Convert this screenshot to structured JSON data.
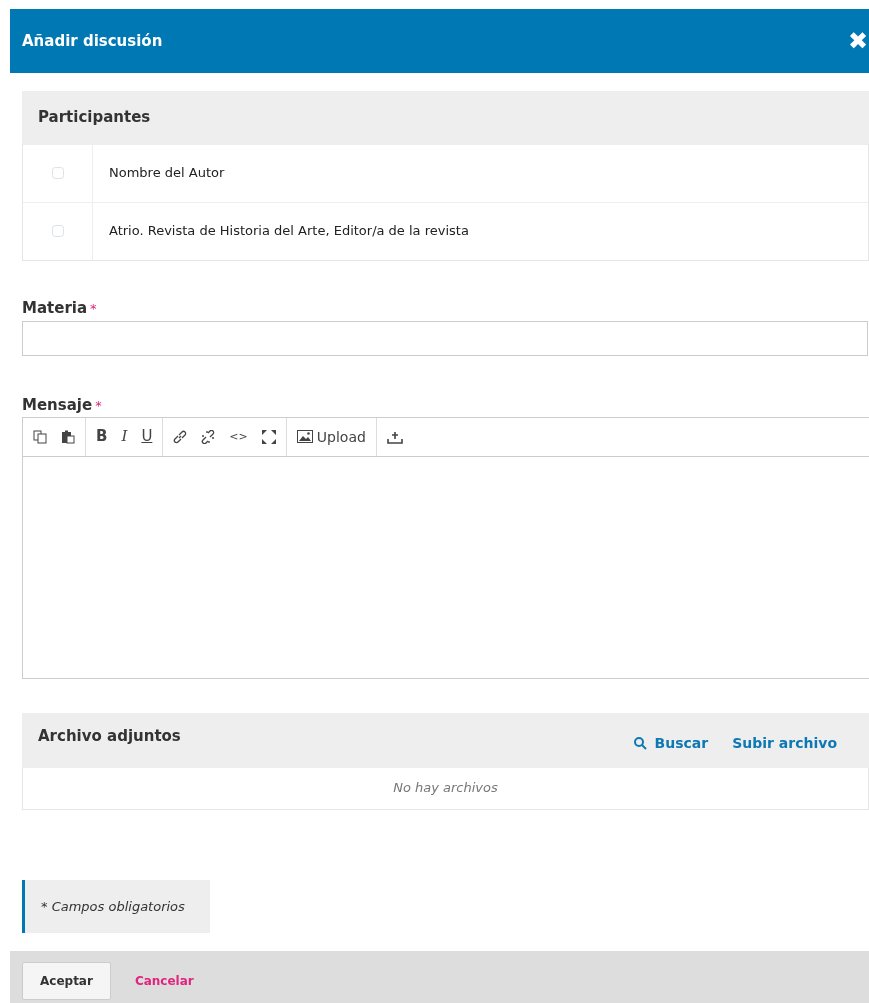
{
  "dialog": {
    "title": "Añadir discusión",
    "close": "✖"
  },
  "participants": {
    "heading": "Participantes",
    "rows": [
      {
        "name": "Nombre del Autor",
        "checked": false
      },
      {
        "name": "Atrio. Revista de Historia del Arte, Editor/a de la revista",
        "checked": false
      }
    ]
  },
  "subject": {
    "label": "Materia",
    "required_mark": "*"
  },
  "message": {
    "label": "Mensaje",
    "required_mark": "*",
    "toolbar": [
      [
        {
          "kind": "copy"
        },
        {
          "kind": "paste"
        }
      ],
      [
        {
          "kind": "bold",
          "label": "B"
        },
        {
          "kind": "italic",
          "label": "I"
        },
        {
          "kind": "underline",
          "label": "U"
        }
      ],
      [
        {
          "kind": "link"
        },
        {
          "kind": "unlink"
        },
        {
          "kind": "code",
          "label": "<>"
        },
        {
          "kind": "fullscreen"
        }
      ],
      [
        {
          "kind": "image",
          "label": "Upload"
        }
      ],
      [
        {
          "kind": "upload"
        }
      ]
    ]
  },
  "attachments": {
    "heading": "Archivo adjuntos",
    "actions": [
      {
        "label": "Buscar",
        "kind": "search"
      },
      {
        "label": "Subir archivo",
        "kind": "plain"
      }
    ],
    "empty": "No hay archivos"
  },
  "required_note": "* Campos obligatorios",
  "footer": {
    "buttons": [
      {
        "label": "Aceptar",
        "kind": "primary"
      },
      {
        "label": "Cancelar",
        "kind": "link"
      }
    ]
  }
}
